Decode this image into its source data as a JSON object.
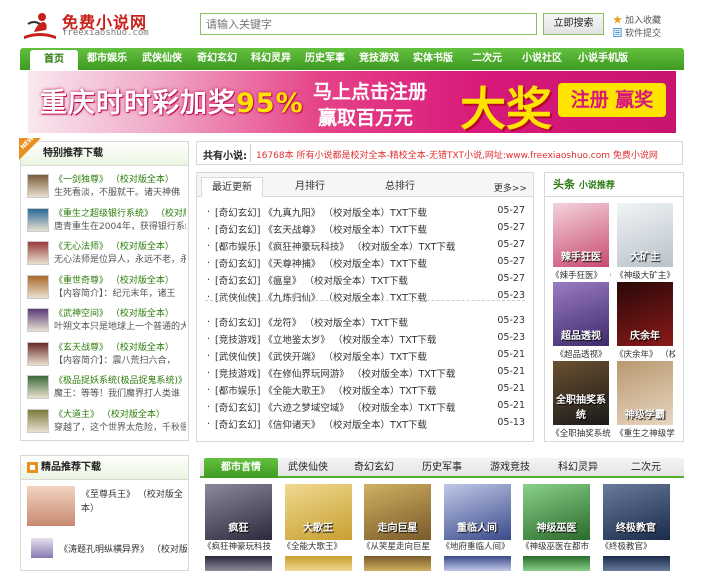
{
  "header": {
    "logo_text": "免费小说网",
    "logo_sub": "freexiaoshuo.com",
    "search_placeholder": "请输入关键字",
    "search_button": "立即搜索",
    "quick_links": [
      "加入收藏",
      "软件提交"
    ]
  },
  "nav": {
    "items": [
      "首页",
      "都市娱乐",
      "武侠仙侠",
      "奇幻玄幻",
      "科幻灵异",
      "历史军事",
      "竞技游戏",
      "实体书版",
      "二次元",
      "小说社区",
      "小说手机版"
    ]
  },
  "banner": {
    "left_text": "重庆时时彩加奖",
    "left_percent": "95%",
    "mid_line1": "马上点击注册",
    "mid_line2": "赢取百万元",
    "big_text": "大奖",
    "button_text": "注册 赢奖"
  },
  "recommend": {
    "title": "特别推荐下载",
    "new_tag": "NEW",
    "items": [
      {
        "title": "《一剑独尊》 （校对版全本）",
        "desc": "生死看淡，不服就干。诸天神佛"
      },
      {
        "title": "《重生之超级银行系统》 （校对版",
        "desc": "唐青重生在2004年，获得银行系统"
      },
      {
        "title": "《无心法师》 （校对版全本）",
        "desc": "无心法师是位异人，永远不老，永"
      },
      {
        "title": "《重世奇尊》 （校对版全本）",
        "desc": "【内容简介】：纪元末年，诸王"
      },
      {
        "title": "《武神空间》 （校对版全本）",
        "desc": "叶朔文本只是地球上一个普通的大"
      },
      {
        "title": "《玄天战尊》 （校对版全本）",
        "desc": "【内容简介】：震八荒扫六合，"
      },
      {
        "title": "《极品捉妖系统(极品捉鬼系统)》",
        "desc": "魔王：等等！我们魔界打人类谁"
      },
      {
        "title": "《大道主》 （校对版全本）",
        "desc": "穿越了，这个世界太危险，千秋很"
      }
    ]
  },
  "marquee": {
    "label": "共有小说:",
    "text": "16768本 所有小说都是校对全本-精校全本-无错TXT小说,网址:www.freexiaoshuo.com 免费小说网"
  },
  "latest": {
    "tabs": [
      "最近更新",
      "月排行",
      "总排行"
    ],
    "more": "更多>>",
    "rows": [
      {
        "cat": "[奇幻玄幻]",
        "name": "《九真九阳》 （校对版全本）TXT下载",
        "date": "05-27"
      },
      {
        "cat": "[奇幻玄幻]",
        "name": "《玄天战尊》 （校对版全本）TXT下载",
        "date": "05-27"
      },
      {
        "cat": "[都市娱乐]",
        "name": "《疯狂神豪玩科技》 （校对版全本）TXT下载",
        "date": "05-27"
      },
      {
        "cat": "[奇幻玄幻]",
        "name": "《天尊神捕》 （校对版全本）TXT下载",
        "date": "05-27"
      },
      {
        "cat": "[奇幻玄幻]",
        "name": "《瘟皇》 （校对版全本）TXT下载",
        "date": "05-27"
      },
      {
        "cat": "[武侠仙侠]",
        "name": "《九炼归仙》 （校对版全本）TXT下载",
        "date": "05-23"
      },
      {
        "cat": "[奇幻玄幻]",
        "name": "《龙符》 （校对版全本）TXT下载",
        "date": "05-23"
      },
      {
        "cat": "[竞技游戏]",
        "name": "《立地鉴太岁》 （校对版全本）TXT下载",
        "date": "05-23"
      },
      {
        "cat": "[武侠仙侠]",
        "name": "《武侠开端》 （校对版全本）TXT下载",
        "date": "05-21"
      },
      {
        "cat": "[竞技游戏]",
        "name": "《在修仙界玩网游》 （校对版全本）TXT下载",
        "date": "05-21"
      },
      {
        "cat": "[都市娱乐]",
        "name": "《全能大歌王》 （校对版全本）TXT下载",
        "date": "05-21"
      },
      {
        "cat": "[奇幻玄幻]",
        "name": "《六迹之梦域空域》 （校对版全本）TXT下载",
        "date": "05-21"
      },
      {
        "cat": "[奇幻玄幻]",
        "name": "《信仰诸天》 （校对版全本）TXT下载",
        "date": "05-13"
      }
    ]
  },
  "headline": {
    "title": "头条",
    "subtitle": "小说推荐",
    "covers": [
      {
        "label": "《辣手狂医》 （校",
        "color1": "#c84a70",
        "color2": "#f3d3db",
        "text": "辣手狂医"
      },
      {
        "label": "《神级大矿主》",
        "color1": "#b8c2ca",
        "color2": "#f1f4f6",
        "text": "大矿主"
      },
      {
        "label": "《超品透视》",
        "color1": "#3d2a6a",
        "color2": "#9b7cc4",
        "text": "超品透视"
      },
      {
        "label": "《庆余年》 （校",
        "color1": "#8a1a1a",
        "color2": "#2a0808",
        "text": "庆余年"
      },
      {
        "label": "《全职抽奖系统",
        "color1": "#1a1a1a",
        "color2": "#6a5030",
        "text": "全职抽奖系统"
      },
      {
        "label": "《重生之神级学",
        "color1": "#e8d6c0",
        "color2": "#b89870",
        "text": "神级学霸"
      }
    ]
  },
  "boutique": {
    "title": "精品推荐下载",
    "items": [
      {
        "title": "《至尊兵王》 （校对版全本）"
      },
      {
        "title": "《涛题孔明纵横异界》 （校对版全"
      }
    ]
  },
  "categories": {
    "tabs": [
      "都市言情",
      "武侠仙侠",
      "奇幻玄幻",
      "历史军事",
      "游戏竞技",
      "科幻灵异",
      "二次元"
    ],
    "books": [
      {
        "label": "《疯狂神豪玩科技",
        "c1": "#2a2a3a",
        "c2": "#8a8a9a",
        "text": "疯狂"
      },
      {
        "label": "《全能大歌王》",
        "c1": "#c8a030",
        "c2": "#f0d890",
        "text": "大歌王"
      },
      {
        "label": "《从笑星走向巨星",
        "c1": "#7a5a2a",
        "c2": "#d0b060",
        "text": "走向巨星"
      },
      {
        "label": "《地府重临人间》",
        "c1": "#3a4a8a",
        "c2": "#c0c8e8",
        "text": "重临人间"
      },
      {
        "label": "《神级巫医在都市",
        "c1": "#2a6a2a",
        "c2": "#8ad08a",
        "text": "神级巫医"
      },
      {
        "label": "《终极教官》",
        "c1": "#1a2a4a",
        "c2": "#6a7a9a",
        "text": "终极教官"
      }
    ]
  },
  "colors": {
    "brand_green": "#3e9a22",
    "accent_red": "#c8201a",
    "banner_pink": "#d8197a"
  }
}
